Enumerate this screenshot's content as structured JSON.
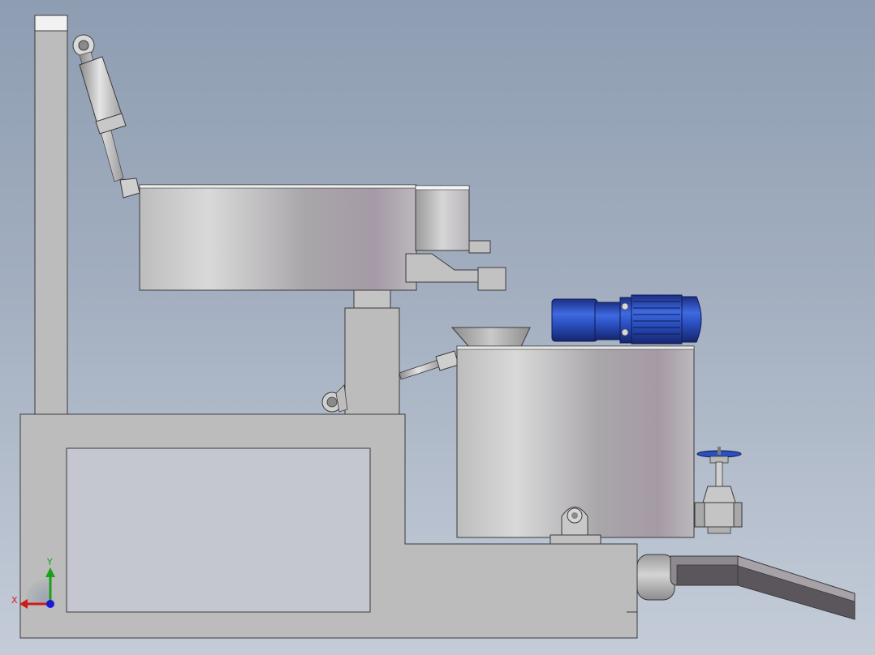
{
  "triad": {
    "x_label": "X",
    "y_label": "Y",
    "x_color": "#d11a1a",
    "y_color": "#1aa01a",
    "z_color": "#1a1ad1"
  },
  "colors": {
    "frame": "#bcbcbc",
    "frame_edge": "#3a3a3a",
    "motor_blue": "#2a4fbf",
    "motor_dark": "#1a2f80",
    "chute_dark": "#5a565c"
  }
}
